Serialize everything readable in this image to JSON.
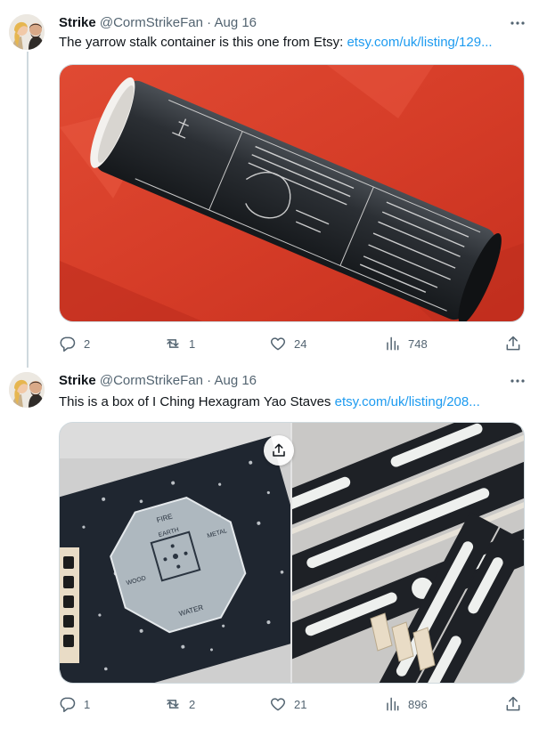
{
  "tweets": [
    {
      "name": "Strike",
      "handle": "@CormStrikeFan",
      "separator": "·",
      "date": "Aug 16",
      "text": "The yarrow stalk container is this one from Etsy: ",
      "link": "etsy.com/uk/listing/129...",
      "image_icon": "yarrow-stalk-container-photo",
      "stats": {
        "replies": "2",
        "reposts": "1",
        "likes": "24",
        "views": "748"
      }
    },
    {
      "name": "Strike",
      "handle": "@CormStrikeFan",
      "separator": "·",
      "date": "Aug 16",
      "text": "This is a box of I Ching Hexagram Yao Staves ",
      "link": "etsy.com/uk/listing/208...",
      "image_icons": [
        "yao-staves-box-photo",
        "yao-staves-photo"
      ],
      "box_labels": {
        "top": "FIRE",
        "center": "EARTH",
        "left": "WOOD",
        "right": "METAL",
        "bottom": "WATER"
      },
      "stats": {
        "replies": "1",
        "reposts": "2",
        "likes": "21",
        "views": "896"
      }
    }
  ],
  "icons": {
    "more": "more-icon",
    "reply": "reply-icon",
    "repost": "repost-icon",
    "like": "heart-icon",
    "views": "views-icon",
    "share": "share-icon"
  },
  "colors": {
    "text": "#0f1419",
    "secondary": "#536471",
    "link": "#1d9bf0",
    "divider": "#cfd9de",
    "tube_background": "#d9432d",
    "tube_body": "#2a2e33"
  }
}
